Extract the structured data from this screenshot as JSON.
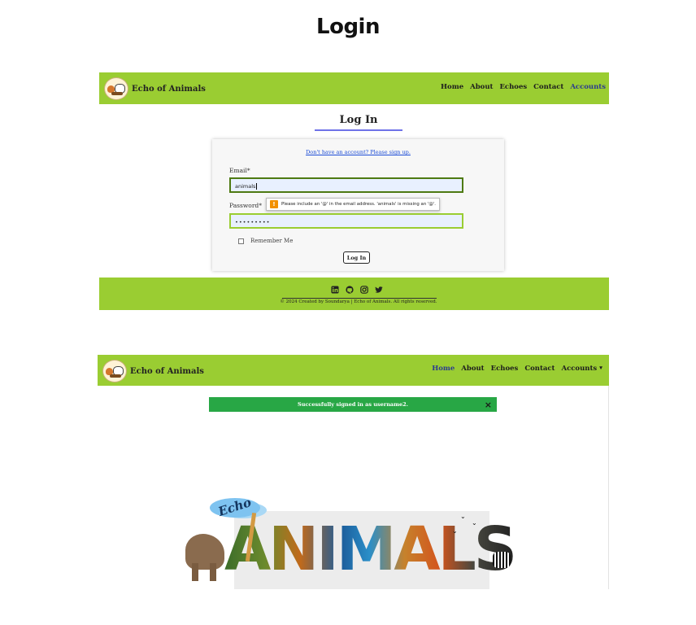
{
  "page_title": "Login",
  "brand": {
    "name": "Echo of Animals"
  },
  "nav": {
    "items": [
      "Home",
      "About",
      "Echoes",
      "Contact",
      "Accounts"
    ]
  },
  "login_page": {
    "heading": "Log In",
    "signup_link": "Don't have an account? Please sign up.",
    "email_label": "Email*",
    "email_value": "animals",
    "password_label": "Password*",
    "password_value": "•••••••••",
    "validation_icon": "!",
    "validation_message": "Please include an '@' in the email address. 'animals' is missing an '@'.",
    "remember_label": "Remember Me",
    "submit_label": "Log In"
  },
  "footer": {
    "icons": [
      "linkedin-icon",
      "github-icon",
      "instagram-icon",
      "twitter-icon"
    ],
    "text": "© 2024 Created by Soundarya | Echo of Animals. All rights reserved."
  },
  "home_page": {
    "accounts_label": "Accounts",
    "alert_message": "Successfully signed in as username2.",
    "alert_close": "×",
    "hero_echo": "Echo",
    "hero_word": "ANIMALS"
  },
  "colors": {
    "navbar": "#9acd32",
    "active_link": "#2c3b8f",
    "alert": "#28a745",
    "underline": "#6f73e8"
  }
}
